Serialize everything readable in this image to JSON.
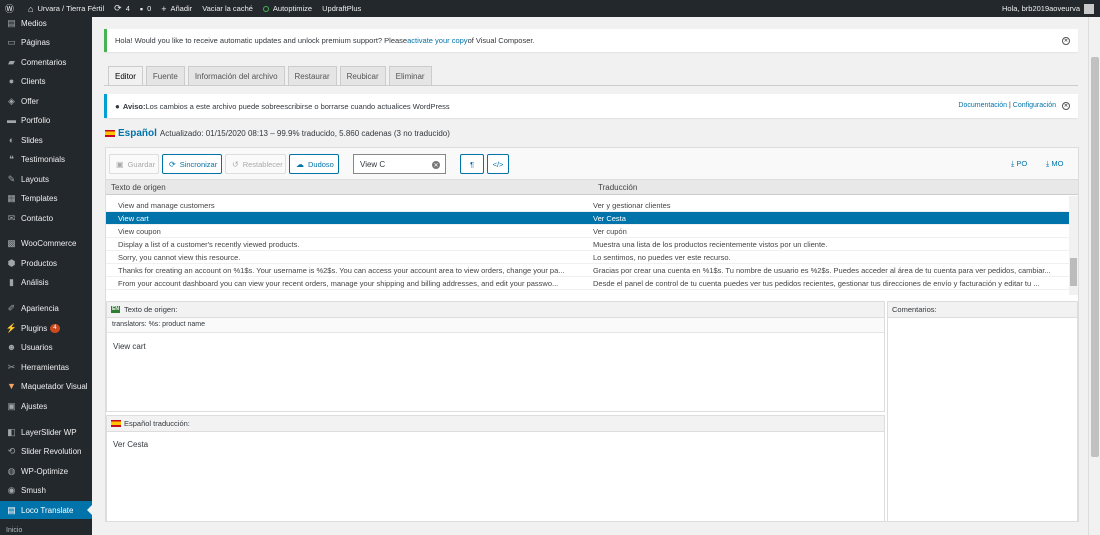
{
  "adminbar": {
    "site": "Urvara / Tierra Fértil",
    "updates": "4",
    "comments": "0",
    "add": "Añadir",
    "clear_cache": "Vaciar la caché",
    "autoptimize": "Autoptimize",
    "updraft": "UpdraftPlus",
    "greeting": "Hola, brb2019aoveurva"
  },
  "sidebar": {
    "items": [
      {
        "label": "Medios",
        "icon": "media-icon"
      },
      {
        "label": "Páginas",
        "icon": "pages-icon"
      },
      {
        "label": "Comentarios",
        "icon": "comments-icon"
      },
      {
        "label": "Clients",
        "icon": "clients-icon"
      },
      {
        "label": "Offer",
        "icon": "offer-icon"
      },
      {
        "label": "Portfolio",
        "icon": "portfolio-icon"
      },
      {
        "label": "Slides",
        "icon": "slides-icon"
      },
      {
        "label": "Testimonials",
        "icon": "quote-icon"
      },
      {
        "label": "Layouts",
        "icon": "layouts-icon"
      },
      {
        "label": "Templates",
        "icon": "templates-icon"
      },
      {
        "label": "Contacto",
        "icon": "mail-icon"
      },
      {
        "label": "WooCommerce",
        "icon": "woocommerce-icon"
      },
      {
        "label": "Productos",
        "icon": "products-icon"
      },
      {
        "label": "Análisis",
        "icon": "chart-icon"
      },
      {
        "label": "Apariencia",
        "icon": "appearance-icon"
      },
      {
        "label": "Plugins",
        "icon": "plugins-icon",
        "badge": "4"
      },
      {
        "label": "Usuarios",
        "icon": "users-icon"
      },
      {
        "label": "Herramientas",
        "icon": "tools-icon"
      },
      {
        "label": "Maquetador Visual",
        "icon": "visual-composer-icon"
      },
      {
        "label": "Ajustes",
        "icon": "settings-icon"
      },
      {
        "label": "LayerSlider WP",
        "icon": "layerslider-icon"
      },
      {
        "label": "Slider Revolution",
        "icon": "revslider-icon"
      },
      {
        "label": "WP-Optimize",
        "icon": "optimize-icon"
      },
      {
        "label": "Smush",
        "icon": "smush-icon"
      },
      {
        "label": "Loco Translate",
        "icon": "loco-icon"
      }
    ],
    "sub_label": "Inicio"
  },
  "notice_update": {
    "before": "Hola! Would you like to receive automatic updates and unlock premium support? Please ",
    "link": "activate your copy",
    "after": " of Visual Composer."
  },
  "tabs": [
    "Editor",
    "Fuente",
    "Información del archivo",
    "Restaurar",
    "Reubicar",
    "Eliminar"
  ],
  "notice_warning": {
    "strong": "Aviso:",
    "text": " Los cambios a este archivo puede sobreescribirse o borrarse cuando actualices WordPress",
    "doc_link": "Documentación",
    "sep": "|",
    "config_link": "Configuración"
  },
  "language": {
    "name": "Español",
    "status": "Actualizado: 01/15/2020 08:13 – 99.9% traducido, 5.860 cadenas (3 no traducido)"
  },
  "toolbar": {
    "save": "Guardar",
    "sync": "Sincronizar",
    "revert": "Restablecer",
    "fuzzy": "Dudoso",
    "search_value": "View C",
    "pilcrow": "¶",
    "code": "</>",
    "po": "PO",
    "mo": "MO"
  },
  "table": {
    "source_header": "Texto de origen",
    "target_header": "Traducción",
    "rows": [
      {
        "source": "View and manage customers",
        "target": "Ver y gestionar clientes",
        "selected": false
      },
      {
        "source": "View cart",
        "target": "Ver Cesta",
        "selected": true
      },
      {
        "source": "View coupon",
        "target": "Ver cupón",
        "selected": false
      },
      {
        "source": "Display a list of a customer's recently viewed products.",
        "target": "Muestra una lista de los productos recientemente vistos por un cliente.",
        "selected": false
      },
      {
        "source": "Sorry, you cannot view this resource.",
        "target": "Lo sentimos, no puedes ver este recurso.",
        "selected": false
      },
      {
        "source": "Thanks for creating an account on %1$s. Your username is %2$s. You can access your account area to view orders, change your pa...",
        "target": "Gracias por crear una cuenta en %1$s. Tu nombre de usuario es %2$s. Puedes acceder al área de tu cuenta para ver pedidos, cambiar...",
        "selected": false
      },
      {
        "source": "From your account dashboard you can view your recent orders, manage your shipping and billing addresses, and edit your passwo...",
        "target": "Desde el panel de control de tu cuenta puedes ver tus pedidos recientes, gestionar tus direcciones de envío y facturación y editar tu ...",
        "selected": false
      }
    ]
  },
  "source_pane": {
    "lang_code": "EN",
    "title": "Texto de origen:",
    "context": "translators: %s: product name",
    "text": "View cart"
  },
  "comments_pane": {
    "title": "Comentarios:"
  },
  "target_pane": {
    "title": "Español traducción:",
    "text": "Ver Cesta"
  }
}
